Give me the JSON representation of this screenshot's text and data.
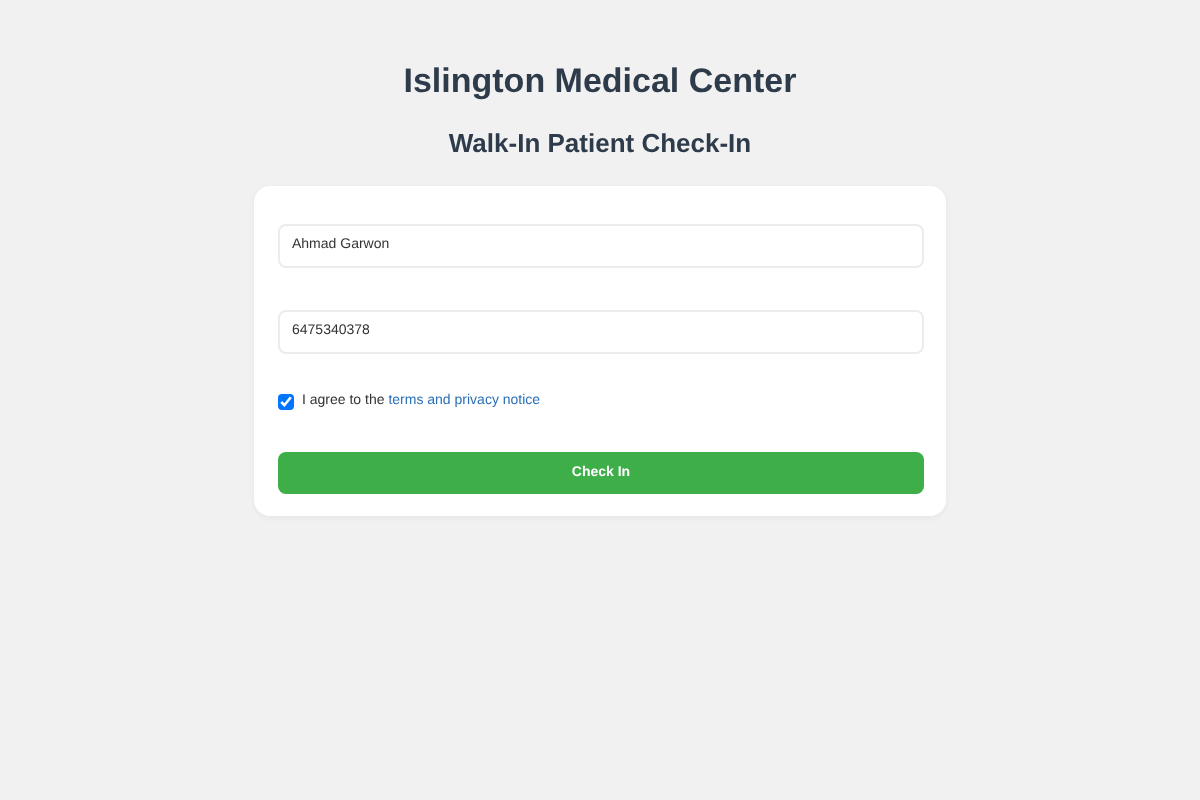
{
  "title": "Islington Medical Center",
  "subtitle": "Walk-In Patient Check-In",
  "fields": [
    {
      "value": "Ahmad Garwon"
    },
    {
      "value": "6475340378"
    }
  ],
  "consent": {
    "checked": true,
    "text": "I agree to the",
    "link": "terms and privacy notice"
  },
  "submit": {
    "label": "Check In"
  }
}
